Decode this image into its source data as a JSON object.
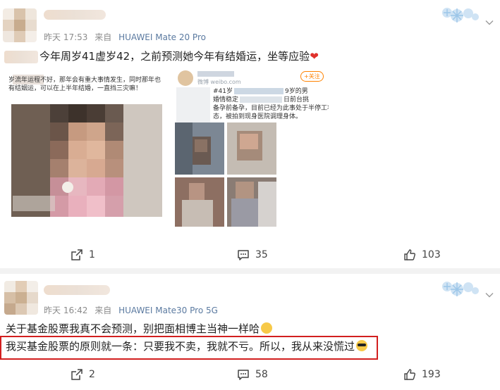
{
  "posts": [
    {
      "time": "昨天 17:53",
      "source_prefix": "来自",
      "device": "HUAWEI Mate 20 Pro",
      "text_prefix": "今年周岁41虚岁42，之前预测她今年有结婚运，坐等应验",
      "text_emoji": "heart-emoji",
      "embedded": {
        "left_image_caption": "岁流年运程不好，那年会有重大事情发生，同时那年也有结姻运，可以在上半年结婚，一直挡三灾嘛！",
        "right_image_follow": "+关注",
        "right_image_url": "微博 weibo.com",
        "right_image_line1": "#41岁",
        "right_image_line2": "9岁的男",
        "right_image_line3": "婚情稳定",
        "right_image_line4": "日前台挑",
        "right_image_line5": "备孕前备孕，目前已经为此事处于半停工状",
        "right_image_line6": "态，被拍到现身医院调理身体。"
      },
      "actions": {
        "share": "1",
        "comment": "35",
        "like": "103"
      }
    },
    {
      "time": "昨天 16:42",
      "source_prefix": "来自",
      "device": "HUAWEI Mate30 Pro 5G",
      "line1": "关于基金股票我真不会预测，别把面相博主当神一样哈",
      "line1_emoji": "sweat-emoji",
      "line2": "我买基金股票的原则就一条：只要我不卖，我就不亏。所以，我从来没慌过",
      "line2_emoji": "sunglasses-emoji",
      "actions": {
        "share": "2",
        "comment": "58",
        "like": "193"
      }
    }
  ],
  "colors": {
    "highlight_border": "#d21f1f",
    "device_link": "#5b7aa0",
    "meta_gray": "#8b8b8b",
    "background": "#f2f2f2"
  }
}
